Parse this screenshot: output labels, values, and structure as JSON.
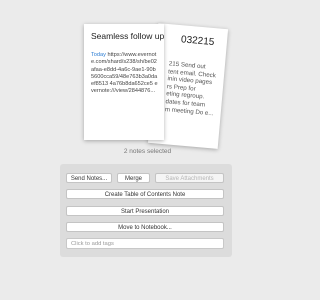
{
  "notes": {
    "back": {
      "title": "032215",
      "body_lines": [
        "215 Send out",
        "tent email. Check",
        "inin video pages",
        "rs Prep for",
        "eting regroup.",
        "dates for team",
        "m meeting Do e..."
      ]
    },
    "front": {
      "title": "Seamless follow up",
      "today": "Today",
      "body": " https://www.evernote.com/shard/s238/sh/be02afaa-e8dd-4a6c-9ae1-90b5600cca59/48e763b3a0daef8513 4a76b8da652ce5 evernote:///view/2844876..."
    }
  },
  "selection": {
    "label": "2 notes selected"
  },
  "actions": {
    "send_notes": "Send Notes...",
    "merge": "Merge",
    "save_attachments": "Save Attachments",
    "create_toc": "Create Table of Contents Note",
    "start_presentation": "Start Presentation",
    "move_to_notebook": "Move to Notebook..."
  },
  "tags": {
    "placeholder": "Click to add tags"
  }
}
